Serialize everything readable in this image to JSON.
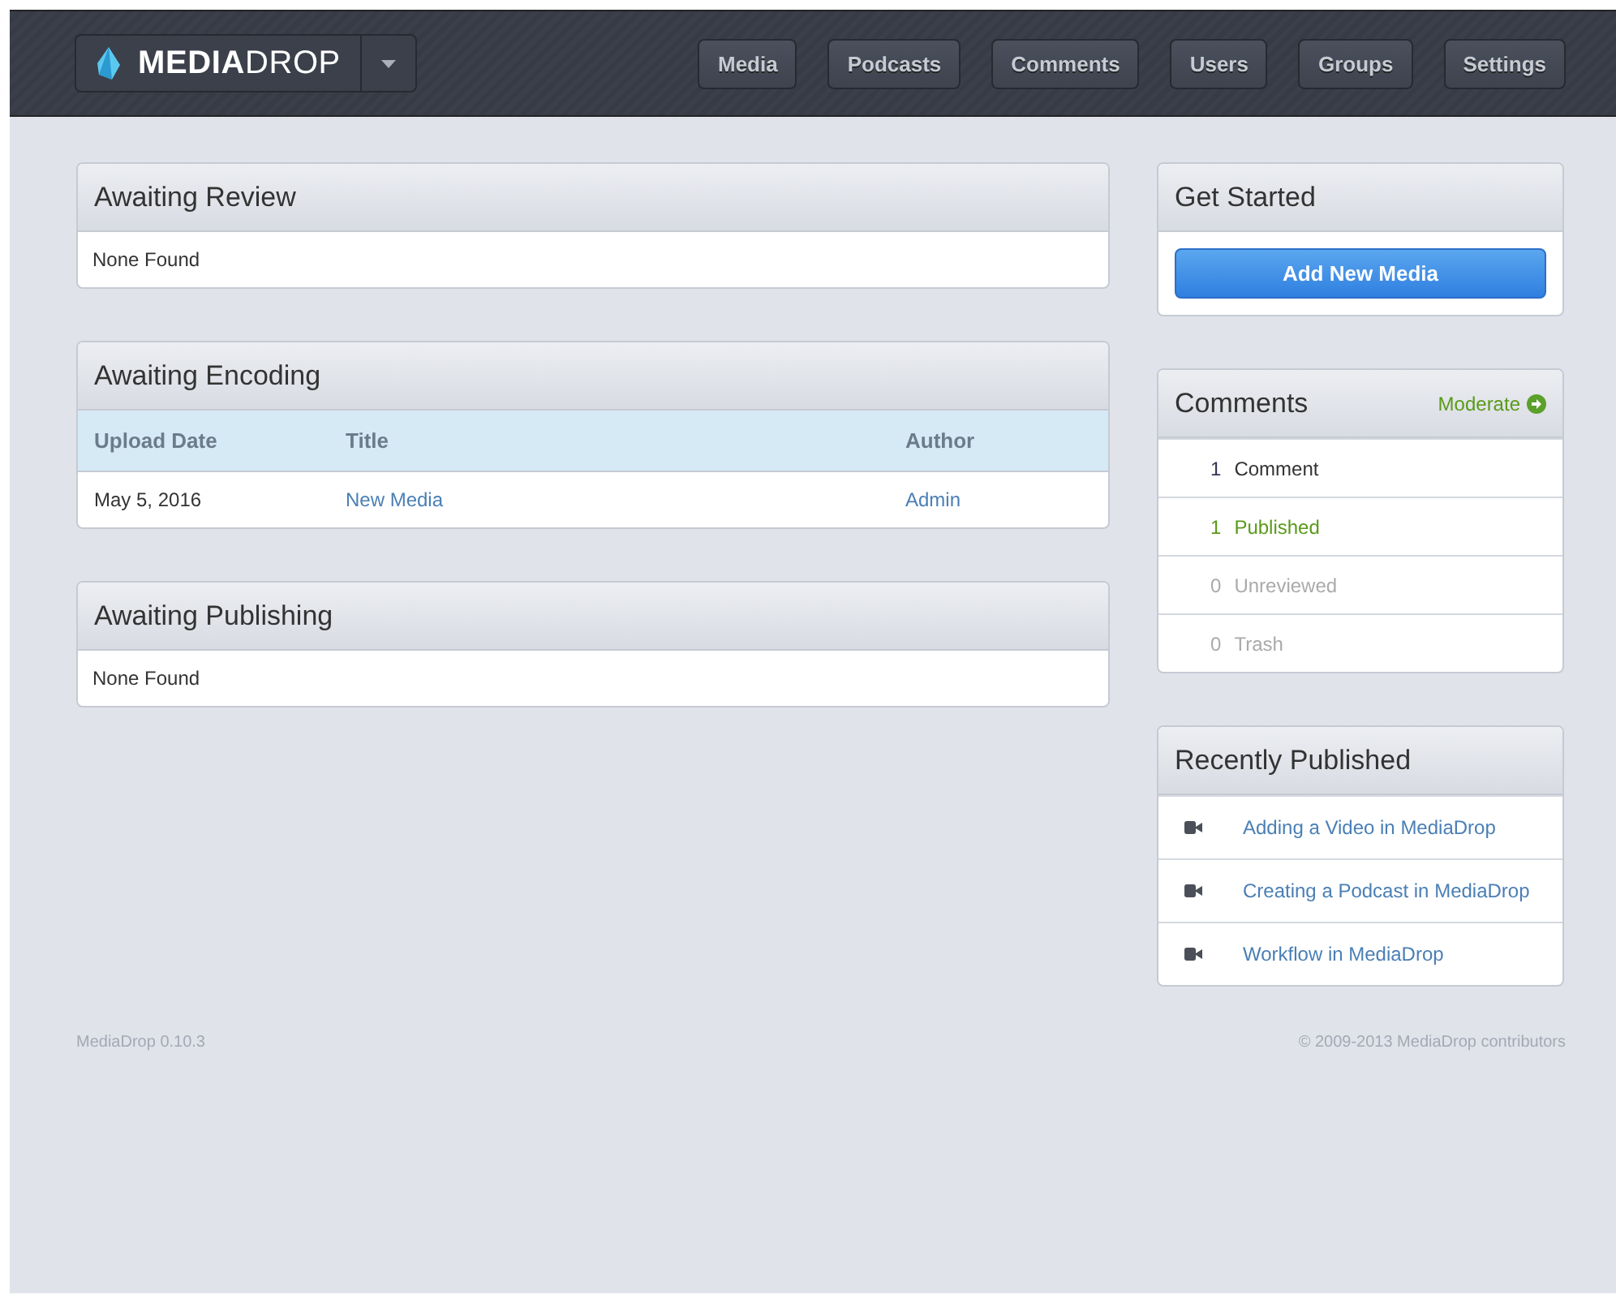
{
  "header": {
    "logo": "**MEDIA**DROP",
    "nav": [
      "Media",
      "Podcasts",
      "Comments",
      "Users",
      "Groups",
      "Settings"
    ]
  },
  "awaiting_review": {
    "title": "Awaiting Review",
    "message": "None Found"
  },
  "awaiting_encoding": {
    "title": "Awaiting Encoding",
    "columns": [
      "Upload Date",
      "Title",
      "Author"
    ],
    "rows": [
      {
        "upload_date": "May 5, 2016",
        "title": "New Media",
        "author": "Admin"
      }
    ]
  },
  "awaiting_publishing": {
    "title": "Awaiting Publishing",
    "message": "None Found"
  },
  "get_started": {
    "title": "Get Started",
    "button": "Add New Media"
  },
  "comments": {
    "title": "Comments",
    "link": "Moderate",
    "items": [
      {
        "kind": "total",
        "count": "1",
        "label": "Comment"
      },
      {
        "kind": "published",
        "count": "1",
        "label": "Published"
      },
      {
        "kind": "unreviewed",
        "count": "0",
        "label": "Unreviewed"
      },
      {
        "kind": "trash",
        "count": "0",
        "label": "Trash"
      }
    ]
  },
  "recently_published": {
    "title": "Recently Published",
    "items": [
      "Adding a Video in MediaDrop",
      "Creating a Podcast in MediaDrop",
      "Workflow in MediaDrop"
    ]
  },
  "footer": {
    "version": "MediaDrop 0.10.3",
    "copyright": "© 2009-2013 MediaDrop contributors"
  }
}
